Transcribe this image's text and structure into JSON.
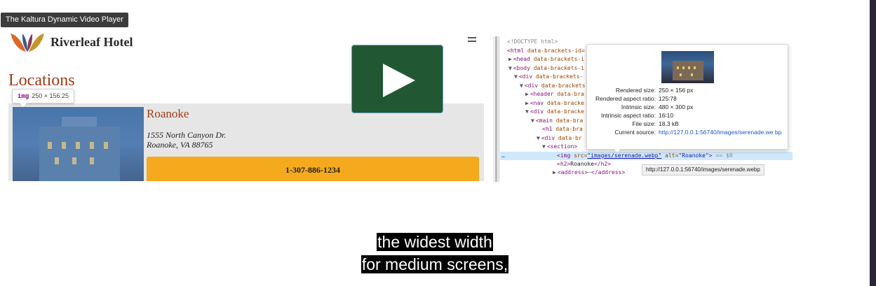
{
  "player": {
    "title": "The Kaltura Dynamic Video Player"
  },
  "site": {
    "brand": "Riverleaf Hotel",
    "heading": "Locations",
    "inspect_tip": {
      "tag": "img",
      "dims": "250 × 156.25"
    },
    "location": {
      "city": "Roanoke",
      "address_line1": "1555 North Canyon Dr.",
      "address_line2": "Roanoke, VA 88765",
      "phone": "1-307-886-1234"
    }
  },
  "devtools": {
    "lines": [
      {
        "indent": 20,
        "tri": "",
        "html": "<!DOCTYPE html>"
      },
      {
        "indent": 20,
        "tri": "",
        "tag": "<html ",
        "attr": "data-brackets-id="
      },
      {
        "indent": 22,
        "tri": "▶",
        "tag": "<head ",
        "attr": "data-brackets-i"
      },
      {
        "indent": 22,
        "tri": "▼",
        "tag": "<body ",
        "attr": "data-brackets-i"
      },
      {
        "indent": 30,
        "tri": "▼",
        "tag": "<div ",
        "attr": "data-brackets-"
      },
      {
        "indent": 38,
        "tri": "▼",
        "tag": "<div ",
        "attr": "data-brackets"
      },
      {
        "indent": 46,
        "tri": "▶",
        "tag": "<header ",
        "attr": "data-bra"
      },
      {
        "indent": 46,
        "tri": "▶",
        "tag": "<nav ",
        "attr": "data-bracke"
      },
      {
        "indent": 46,
        "tri": "▼",
        "tag": "<div ",
        "attr": "data-bracke"
      },
      {
        "indent": 54,
        "tri": "▼",
        "tag": "<main ",
        "attr": "data-bra"
      },
      {
        "indent": 70,
        "tri": "",
        "tag": "<h1 ",
        "attr": "data-bra"
      },
      {
        "indent": 62,
        "tri": "▼",
        "tag": "<div ",
        "attr": "data-br"
      },
      {
        "indent": 70,
        "tri": "▼",
        "tag": "<section>",
        "attr": ""
      }
    ],
    "selected_line": {
      "prefix": "…",
      "tag_open": "<img ",
      "src_attr": "src=",
      "src_val": "\"images/serenade.webp\"",
      "alt_attr": " alt=",
      "alt_val": "\"Roanoke\"",
      "tag_close": ">",
      "suffix": " == $0"
    },
    "h2_line": {
      "tag_open": "<h2>",
      "text": "Roanoke",
      "tag_close": "</h2>"
    },
    "address_line": {
      "tri": "▶",
      "tag_open": "<address>",
      "dots": "⋯",
      "tag_close": "</address>"
    },
    "url_tooltip": "http://127.0.0.1:56740/images/serenade.webp",
    "preview": {
      "rows": [
        {
          "label": "Rendered size:",
          "value": "250 × 156 px"
        },
        {
          "label": "Rendered aspect ratio:",
          "value": "125∶78"
        },
        {
          "label": "Intrinsic size:",
          "value": "480 × 300 px"
        },
        {
          "label": "Intrinsic aspect ratio:",
          "value": "16∶10"
        },
        {
          "label": "File size:",
          "value": "18.3 kB"
        },
        {
          "label": "Current source:",
          "value": "http://127.0.0.1:56740/images/serenade.we bp"
        }
      ]
    }
  },
  "caption": {
    "line1": "the widest width",
    "line2": "for medium screens,"
  }
}
